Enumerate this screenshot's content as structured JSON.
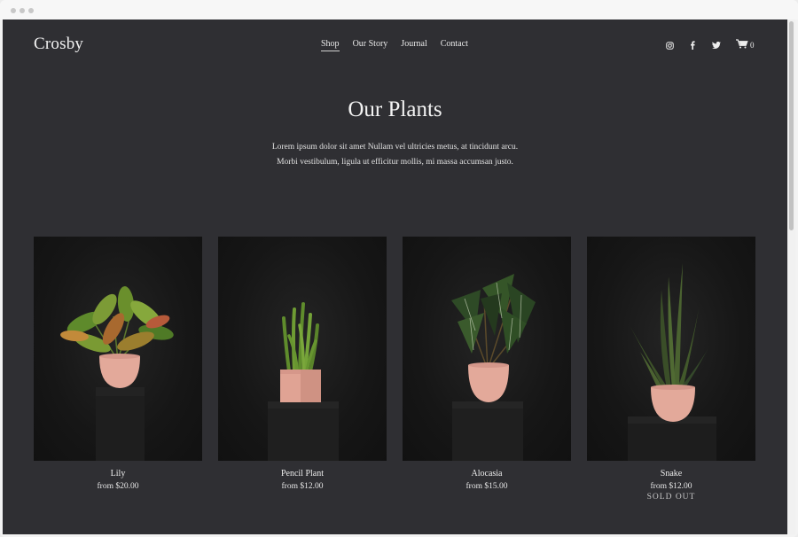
{
  "site": {
    "logo": "Crosby",
    "nav": [
      {
        "label": "Shop",
        "active": true
      },
      {
        "label": "Our Story",
        "active": false
      },
      {
        "label": "Journal",
        "active": false
      },
      {
        "label": "Contact",
        "active": false
      }
    ],
    "social_icons": [
      "instagram-icon",
      "facebook-icon",
      "twitter-icon"
    ],
    "cart": {
      "icon": "cart-icon",
      "count": "0"
    }
  },
  "hero": {
    "title": "Our Plants",
    "lines": [
      "Lorem ipsum dolor sit amet Nullam vel ultricies metus, at tincidunt arcu.",
      "Morbi vestibulum, ligula ut efficitur mollis, mi massa accumsan justo."
    ]
  },
  "products": [
    {
      "name": "Lily",
      "price": "from $20.00",
      "status": ""
    },
    {
      "name": "Pencil Plant",
      "price": "from $12.00",
      "status": ""
    },
    {
      "name": "Alocasia",
      "price": "from $15.00",
      "status": ""
    },
    {
      "name": "Snake",
      "price": "from $12.00",
      "status": "SOLD OUT"
    }
  ],
  "colors": {
    "page_background": "#2f2f33",
    "pot_pink": "#e3a99a",
    "text": "#f2f2f2"
  }
}
